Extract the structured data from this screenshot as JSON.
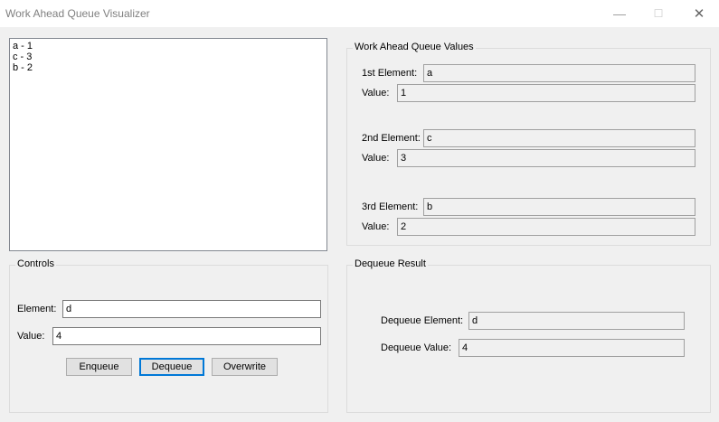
{
  "window": {
    "title": "Work Ahead Queue Visualizer",
    "minimize_icon": "—",
    "maximize_icon": "☐",
    "close_icon": "✕"
  },
  "queue_list": {
    "items": [
      "a - 1",
      "c - 3",
      "b - 2"
    ]
  },
  "values_group": {
    "title": "Work Ahead Queue Values",
    "first_label": "1st Element:",
    "first_element": "a",
    "first_value_label": "Value:",
    "first_value": "1",
    "second_label": "2nd Element:",
    "second_element": "c",
    "second_value_label": "Value:",
    "second_value": "3",
    "third_label": "3rd Element:",
    "third_element": "b",
    "third_value_label": "Value:",
    "third_value": "2"
  },
  "controls": {
    "title": "Controls",
    "element_label": "Element:",
    "element_value": "d",
    "value_label": "Value:",
    "value_value": "4",
    "enqueue_label": "Enqueue",
    "dequeue_label": "Dequeue",
    "overwrite_label": "Overwrite"
  },
  "dequeue_result": {
    "title": "Dequeue Result",
    "element_label": "Dequeue Element:",
    "element_value": "d",
    "value_label": "Dequeue Value:",
    "value_value": "4"
  }
}
